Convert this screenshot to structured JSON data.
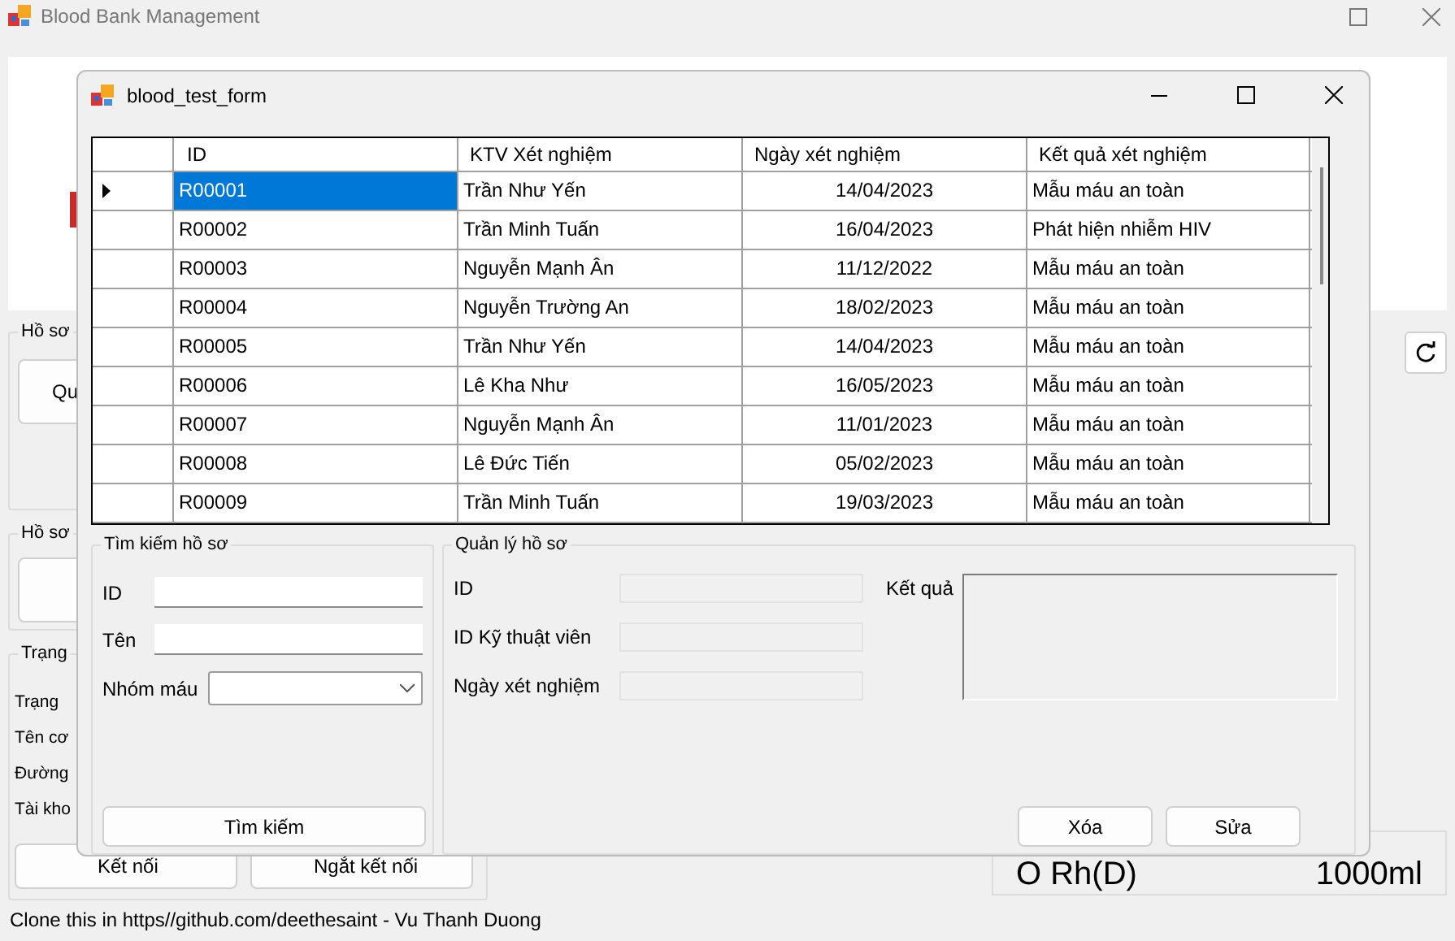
{
  "main_window": {
    "title": "Blood Bank Management",
    "groups": [
      {
        "title": "Hồ sơ",
        "items": [
          {
            "kind": "button",
            "label": "Qu"
          }
        ]
      },
      {
        "title": "Hồ sơ",
        "items": [
          {
            "kind": "button"
          }
        ]
      },
      {
        "title": "Trạng",
        "items": [
          {
            "kind": "label",
            "label": "Trạng"
          },
          {
            "kind": "label",
            "label": "Tên cơ"
          },
          {
            "kind": "label",
            "label": "Đường"
          },
          {
            "kind": "label",
            "label": "Tài kho"
          }
        ]
      }
    ],
    "connection_buttons": [
      "Kết nối",
      "Ngắt kết nối"
    ],
    "blood_summary": {
      "group": "O Rh(D)",
      "volume": "1000ml"
    },
    "footer": "Clone this in https//github.com/deethesaint - Vu Thanh Duong"
  },
  "dialog": {
    "title": "blood_test_form",
    "table": {
      "columns": [
        "ID",
        "KTV Xét nghiệm",
        "Ngày xét nghiệm",
        "Kết quả xét nghiệm"
      ],
      "rows": [
        {
          "selected": true,
          "cells": [
            "R00001",
            "Trần Như Yến",
            "14/04/2023",
            "Mẫu máu an toàn"
          ]
        },
        {
          "selected": false,
          "cells": [
            "R00002",
            "Trần Minh Tuấn",
            "16/04/2023",
            "Phát hiện nhiễm HIV"
          ]
        },
        {
          "selected": false,
          "cells": [
            "R00003",
            "Nguyễn Mạnh Ân",
            "11/12/2022",
            "Mẫu máu an toàn"
          ]
        },
        {
          "selected": false,
          "cells": [
            "R00004",
            "Nguyễn Trường An",
            "18/02/2023",
            "Mẫu máu an toàn"
          ]
        },
        {
          "selected": false,
          "cells": [
            "R00005",
            "Trần Như Yến",
            "14/04/2023",
            "Mẫu máu an toàn"
          ]
        },
        {
          "selected": false,
          "cells": [
            "R00006",
            "Lê Kha Như",
            "16/05/2023",
            "Mẫu máu an toàn"
          ]
        },
        {
          "selected": false,
          "cells": [
            "R00007",
            "Nguyễn Mạnh Ân",
            "11/01/2023",
            "Mẫu máu an toàn"
          ]
        },
        {
          "selected": false,
          "cells": [
            "R00008",
            "Lê Đức Tiến",
            "05/02/2023",
            "Mẫu máu an toàn"
          ]
        },
        {
          "selected": false,
          "cells": [
            "R00009",
            "Trần Minh Tuấn",
            "19/03/2023",
            "Mẫu máu an toàn"
          ]
        }
      ]
    },
    "search": {
      "title": "Tìm kiếm hồ sơ",
      "fields": [
        {
          "label": "ID",
          "kind": "text"
        },
        {
          "label": "Tên",
          "kind": "text"
        },
        {
          "label": "Nhóm máu",
          "kind": "dropdown"
        }
      ],
      "button": "Tìm kiếm"
    },
    "manage": {
      "title": "Quản lý hồ sơ",
      "fields": [
        {
          "label": "ID"
        },
        {
          "label": "ID Kỹ thuật viên"
        },
        {
          "label": "Ngày xét nghiệm"
        }
      ],
      "result_label": "Kết quả",
      "buttons": [
        "Xóa",
        "Sửa"
      ]
    }
  }
}
